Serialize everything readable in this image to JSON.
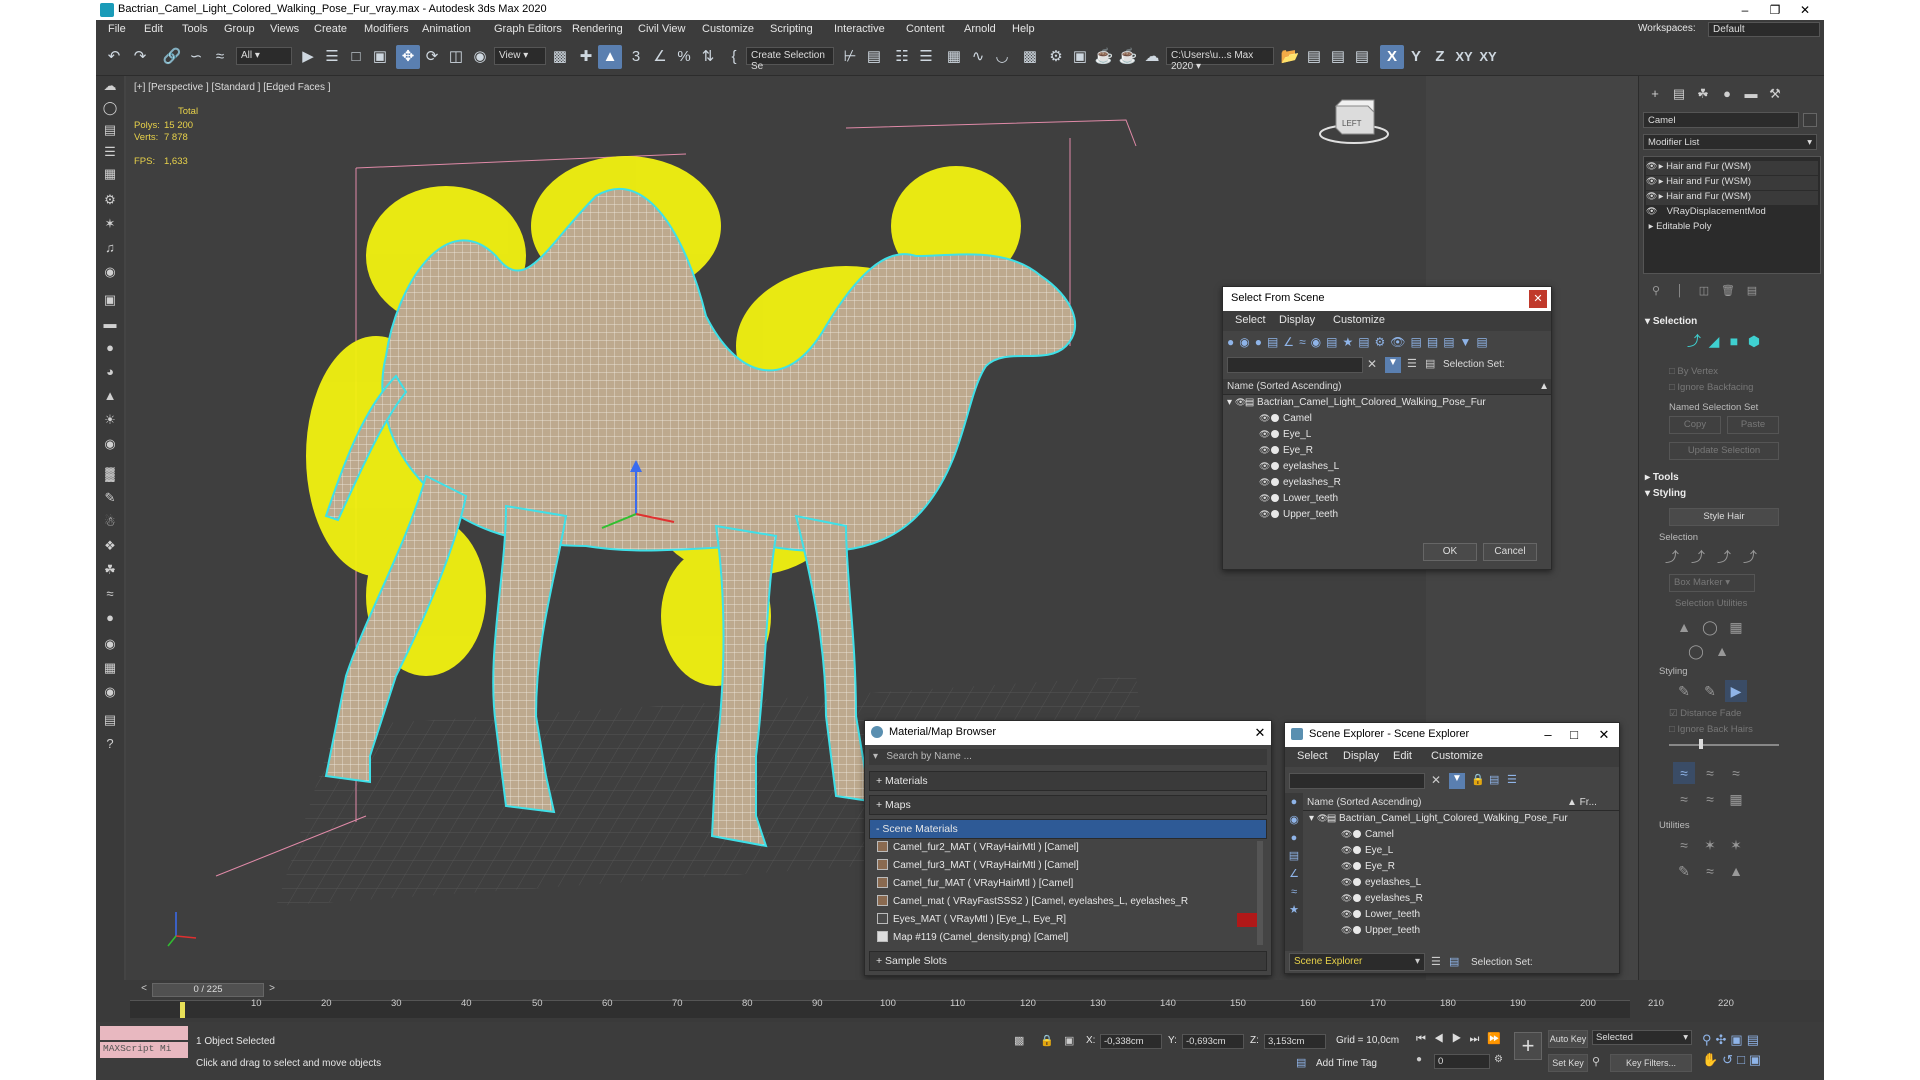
{
  "window": {
    "title": "Bactrian_Camel_Light_Colored_Walking_Pose_Fur_vray.max - Autodesk 3ds Max 2020"
  },
  "menubar": [
    "File",
    "Edit",
    "Tools",
    "Group",
    "Views",
    "Create",
    "Modifiers",
    "Animation",
    "Graph Editors",
    "Rendering",
    "Civil View",
    "Customize",
    "Scripting",
    "Interactive",
    "Content",
    "Arnold",
    "Help"
  ],
  "workspace": {
    "label": "Workspaces:",
    "value": "Default"
  },
  "toolbar": {
    "filter_value": "All",
    "refcoord_value": "View",
    "named_selection_placeholder": "Create Selection Se",
    "project_path": "C:\\Users\\u...s Max 2020",
    "axis_labels": [
      "X",
      "Y",
      "Z",
      "XY",
      "XY"
    ]
  },
  "viewport": {
    "label": "[+] [Perspective ] [Standard ] [Edged Faces ]",
    "stats": {
      "total_label": "Total",
      "polys_label": "Polys:",
      "polys_value": "15 200",
      "verts_label": "Verts:",
      "verts_value": "7 878",
      "fps_label": "FPS:",
      "fps_value": "1,633"
    },
    "viewcube_label": "LEFT"
  },
  "command_panel": {
    "object_name": "Camel",
    "modifier_list_label": "Modifier List",
    "modifier_stack": [
      "Hair and Fur (WSM)",
      "Hair and Fur (WSM)",
      "Hair and Fur (WSM)",
      "VRayDisplacementMod",
      "Editable Poly"
    ],
    "selection_rollout": "Selection",
    "by_vertex": "By Vertex",
    "ignore_backfacing": "Ignore Backfacing",
    "named_selection_set": "Named Selection Set",
    "copy": "Copy",
    "paste": "Paste",
    "update_selection": "Update Selection",
    "tools_rollout": "Tools",
    "styling_rollout": "Styling",
    "style_hair": "Style Hair",
    "selection_group": "Selection",
    "box_marker": "Box Marker",
    "selection_utilities": "Selection Utilities",
    "styling_group": "Styling",
    "distance_fade": "Distance Fade",
    "ignore_back_hairs": "Ignore Back Hairs",
    "utilities_group": "Utilities"
  },
  "select_from_scene": {
    "title": "Select From Scene",
    "menus": [
      "Select",
      "Display",
      "Customize"
    ],
    "selection_set_label": "Selection Set:",
    "column_header": "Name (Sorted Ascending)",
    "root": "Bactrian_Camel_Light_Colored_Walking_Pose_Fur",
    "items": [
      "Camel",
      "Eye_L",
      "Eye_R",
      "eyelashes_L",
      "eyelashes_R",
      "Lower_teeth",
      "Upper_teeth"
    ],
    "ok": "OK",
    "cancel": "Cancel"
  },
  "material_browser": {
    "title": "Material/Map Browser",
    "search_placeholder": "Search by Name ...",
    "sections": {
      "materials": "+ Materials",
      "maps": "+ Maps",
      "scene_materials": "- Scene Materials",
      "sample_slots": "+ Sample Slots"
    },
    "scene_materials": [
      "Camel_fur2_MAT  ( VRayHairMtl ) [Camel]",
      "Camel_fur3_MAT  ( VRayHairMtl ) [Camel]",
      "Camel_fur_MAT  ( VRayHairMtl ) [Camel]",
      "Camel_mat  ( VRayFastSSS2 ) [Camel, eyelashes_L, eyelashes_R, Lower_te...",
      "Eyes_MAT  ( VRayMtl ) [Eye_L, Eye_R]",
      "Map #119 (Camel_density.png)  [Camel]"
    ]
  },
  "scene_explorer": {
    "title": "Scene Explorer - Scene Explorer",
    "menus": [
      "Select",
      "Display",
      "Edit",
      "Customize"
    ],
    "column_header": "Name (Sorted Ascending)",
    "column_fr": "▲ Fr...",
    "root": "Bactrian_Camel_Light_Colored_Walking_Pose_Fur",
    "items": [
      "Camel",
      "Eye_L",
      "Eye_R",
      "eyelashes_L",
      "eyelashes_R",
      "Lower_teeth",
      "Upper_teeth"
    ],
    "explorer_name": "Scene Explorer",
    "selection_set_label": "Selection Set:"
  },
  "timeline": {
    "frame_counter": "0 / 225",
    "ticks": [
      "10",
      "20",
      "30",
      "40",
      "50",
      "60",
      "70",
      "80",
      "90",
      "100",
      "110",
      "120",
      "130",
      "140",
      "150",
      "160",
      "170",
      "180",
      "190",
      "200",
      "210",
      "220"
    ]
  },
  "statusbar": {
    "maxscript": "MAXScript Mi",
    "selected_count": "1 Object Selected",
    "prompt": "Click and drag to select and move objects",
    "x_label": "X:",
    "x_value": "-0,338cm",
    "y_label": "Y:",
    "y_value": "-0,693cm",
    "z_label": "Z:",
    "z_value": "3,153cm",
    "grid": "Grid = 10,0cm",
    "add_time_tag": "Add Time Tag",
    "auto_key": "Auto Key",
    "selected_dropdown": "Selected",
    "set_key": "Set Key",
    "key_filters": "Key Filters...",
    "frame_value": "0"
  }
}
